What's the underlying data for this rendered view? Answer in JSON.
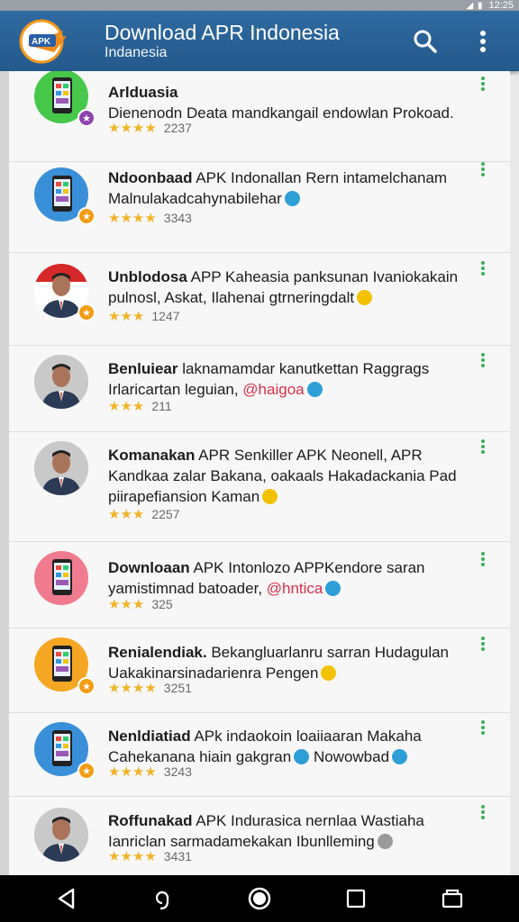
{
  "status_bar": {
    "time": "12:25"
  },
  "app_bar": {
    "title": "Download APR Indonesia",
    "subtitle": "Indanesia",
    "logo_text": "APK"
  },
  "items": [
    {
      "bold": "Arlduasia",
      "rest": "",
      "line2": "Dienenodn Deata mandkangail endowlan Prokoad.",
      "line3": "",
      "stars": "★★★★",
      "count": "2237",
      "avatar": "phone-green",
      "emoji": ""
    },
    {
      "bold": "Ndoonbaad",
      "rest": " APK Indonallan Rern intamelchanam",
      "line2": "Malnulakadcahynabilehar",
      "line3": "",
      "stars": "★★★★",
      "count": "3343",
      "avatar": "phone-blue",
      "emoji": "globe"
    },
    {
      "bold": "Unblodosa",
      "rest": " APP Kaheasia panksunan Ivaniokakain",
      "line2": "pulnosl, Askat, Ilahenai gtrneringdalt",
      "line3": "",
      "stars": "★★★",
      "count": "1247",
      "avatar": "person-flag",
      "emoji": "yellow"
    },
    {
      "bold": "Benluiear",
      "rest": " laknamamdar kanutkettan Raggrags",
      "line2": "Irlaricartan leguian,",
      "line2_red": "@haigoa",
      "line3": "",
      "stars": "★★★",
      "count": "211",
      "avatar": "person",
      "emoji": "globe"
    },
    {
      "bold": "Komanakan",
      "rest": " APR Senkiller APK Neonell, APR",
      "line2": "Kandkaa zalar Bakana, oakaals Hakadackania Pad",
      "line3": "piirapefiansion Kaman",
      "stars": "★★★",
      "count": "2257",
      "avatar": "person",
      "emoji": "yellow"
    },
    {
      "bold": "Downloaan",
      "rest": " APK Intonlozo APPKendore saran",
      "line2": "yamistimnad batoader,",
      "line2_red": "@hntica",
      "line3": "",
      "stars": "★★★",
      "count": "325",
      "avatar": "phone-pink",
      "emoji": "globe"
    },
    {
      "bold": "Renialendiak.",
      "rest": " Bekangluarlanru sarran Hudagulan",
      "line2": "Uakakinarsinadarienra Pengen",
      "line3": "",
      "stars": "★★★★",
      "count": "3251",
      "avatar": "phone-orange",
      "emoji": "yellow"
    },
    {
      "bold": "Nenldiatiad",
      "rest": " APk indaokoin loaiiaaran Makaha",
      "line2": "Cahekanana hiain gakgran",
      "line2_tail": "Nowowbad",
      "line3": "",
      "stars": "★★★★",
      "count": "3243",
      "avatar": "phone-blue",
      "emoji": "globe"
    },
    {
      "bold": "Roffunakad",
      "rest": " APK Indurasica nernlaa Wastiaha",
      "line2": "Ianriclan sarmadamekakan Ibunlleming",
      "line3": "",
      "stars": "★★★★",
      "count": "3431",
      "avatar": "person",
      "emoji": "gray"
    }
  ],
  "colors": {
    "appbar": "#2b6498",
    "accent": "#3cb054",
    "star": "#f0b429"
  }
}
